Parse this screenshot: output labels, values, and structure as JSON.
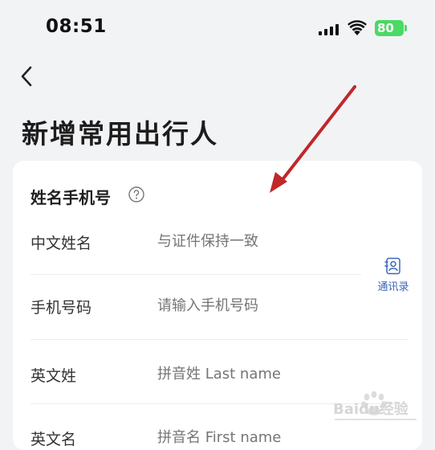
{
  "status_bar": {
    "time": "08:51",
    "battery": "80"
  },
  "header": {
    "title": "新增常用出行人"
  },
  "form": {
    "section_title": "姓名手机号",
    "rows": [
      {
        "label": "中文姓名",
        "placeholder": "与证件保持一致"
      },
      {
        "label": "手机号码",
        "placeholder": "请输入手机号码"
      },
      {
        "label": "英文姓",
        "placeholder": "拼音姓 Last name"
      },
      {
        "label": "英文名",
        "placeholder": "拼音名 First name"
      }
    ],
    "contacts_label": "通讯录"
  },
  "colors": {
    "accent": "#3a66b8",
    "battery": "#4cd964",
    "arrow": "#c0282a"
  },
  "watermark": {
    "text": "Baidu经验"
  }
}
